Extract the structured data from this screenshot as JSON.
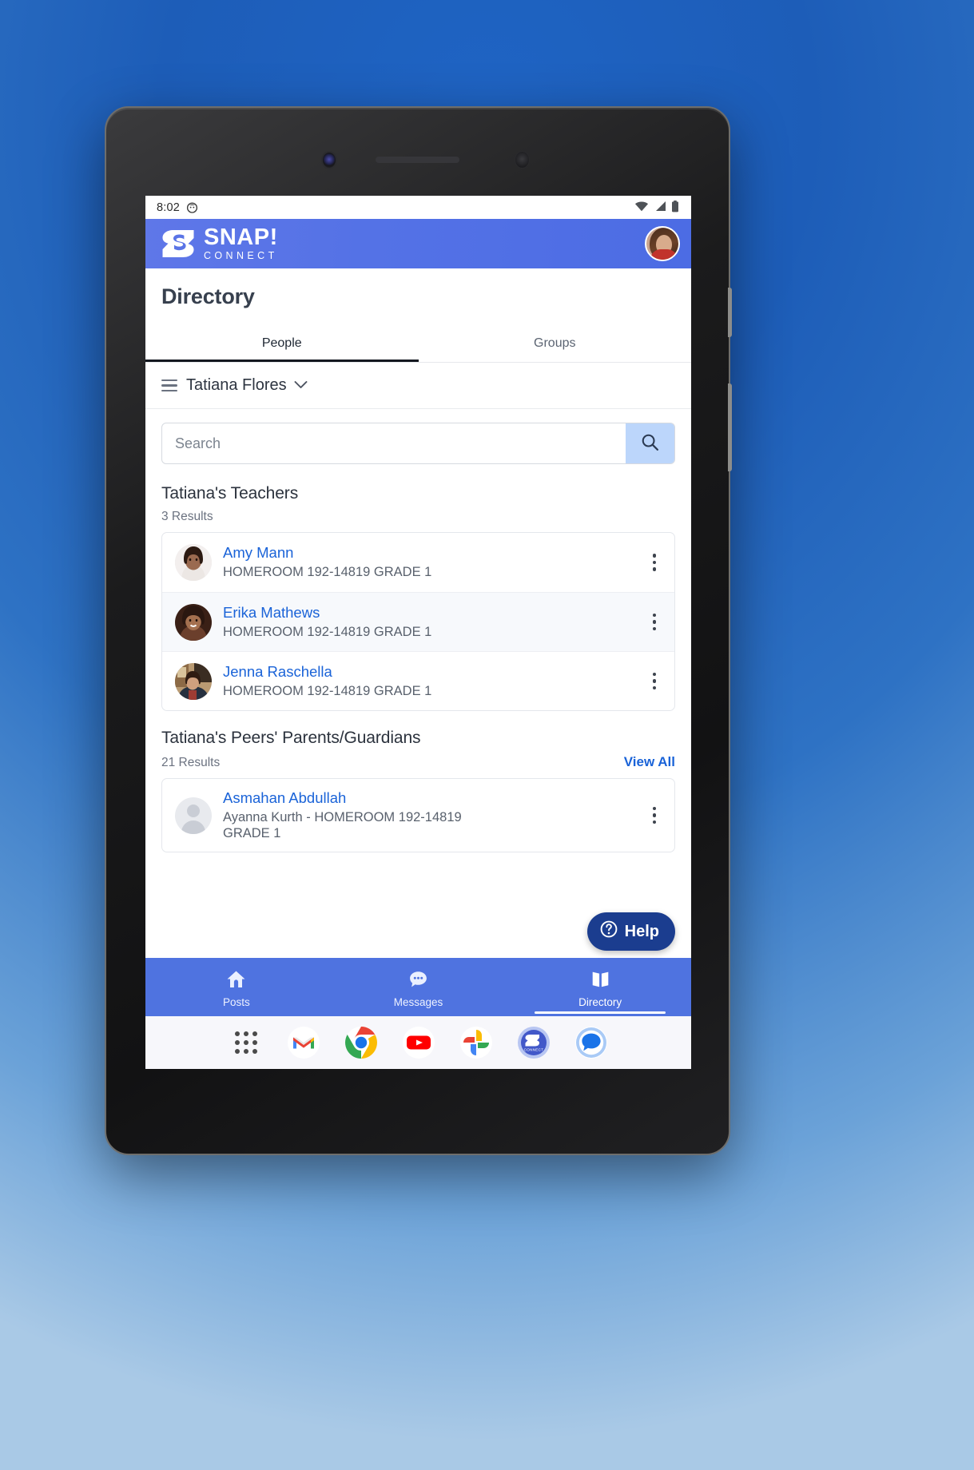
{
  "status_bar": {
    "time": "8:02",
    "left_icon": "clock-face-icon",
    "right_icons": [
      "wifi-icon",
      "cellular-signal-icon",
      "battery-icon"
    ]
  },
  "app_bar": {
    "logo_primary": "SNAP!",
    "logo_secondary": "CONNECT",
    "logo_mark": "snap-s-logo-icon",
    "avatar": "user-avatar"
  },
  "page": {
    "title": "Directory"
  },
  "tabs": [
    {
      "label": "People",
      "active": true
    },
    {
      "label": "Groups",
      "active": false
    }
  ],
  "selector": {
    "menu_icon": "hamburger-icon",
    "name": "Tatiana Flores",
    "chevron": "chevron-down-icon"
  },
  "search": {
    "value": "",
    "placeholder": "Search",
    "button_icon": "search-icon"
  },
  "sections": [
    {
      "title": "Tatiana's Teachers",
      "count": "3 Results",
      "view_all": null,
      "people": [
        {
          "name": "Amy Mann",
          "meta": "HOMEROOM 192-14819 GRADE 1",
          "avatar": "photo",
          "menu": "kebab-menu-icon"
        },
        {
          "name": "Erika Mathews",
          "meta": "HOMEROOM 192-14819 GRADE 1",
          "avatar": "photo",
          "menu": "kebab-menu-icon"
        },
        {
          "name": "Jenna Raschella",
          "meta": "HOMEROOM 192-14819 GRADE 1",
          "avatar": "photo",
          "menu": "kebab-menu-icon"
        }
      ]
    },
    {
      "title": "Tatiana's Peers' Parents/Guardians",
      "count": "21 Results",
      "view_all": "View All",
      "people": [
        {
          "name": "Asmahan Abdullah",
          "meta": "Ayanna Kurth - HOMEROOM 192-14819 GRADE 1",
          "avatar": "placeholder",
          "menu": "kebab-menu-icon"
        }
      ]
    }
  ],
  "help_button": {
    "label": "Help",
    "icon": "question-circle-icon"
  },
  "bottom_nav": [
    {
      "label": "Posts",
      "icon": "home-icon",
      "active": false
    },
    {
      "label": "Messages",
      "icon": "chat-bubble-icon",
      "active": false
    },
    {
      "label": "Directory",
      "icon": "book-icon",
      "active": true
    }
  ],
  "dock": [
    {
      "name": "app-drawer-icon"
    },
    {
      "name": "gmail-icon"
    },
    {
      "name": "chrome-icon"
    },
    {
      "name": "youtube-icon"
    },
    {
      "name": "google-photos-icon"
    },
    {
      "name": "snap-connect-icon"
    },
    {
      "name": "google-messages-icon"
    }
  ],
  "colors": {
    "brand_blue": "#4f73e0",
    "link_blue": "#1a63d8",
    "help_navy": "#1b3d8f",
    "search_btn": "#bcd6fb"
  }
}
